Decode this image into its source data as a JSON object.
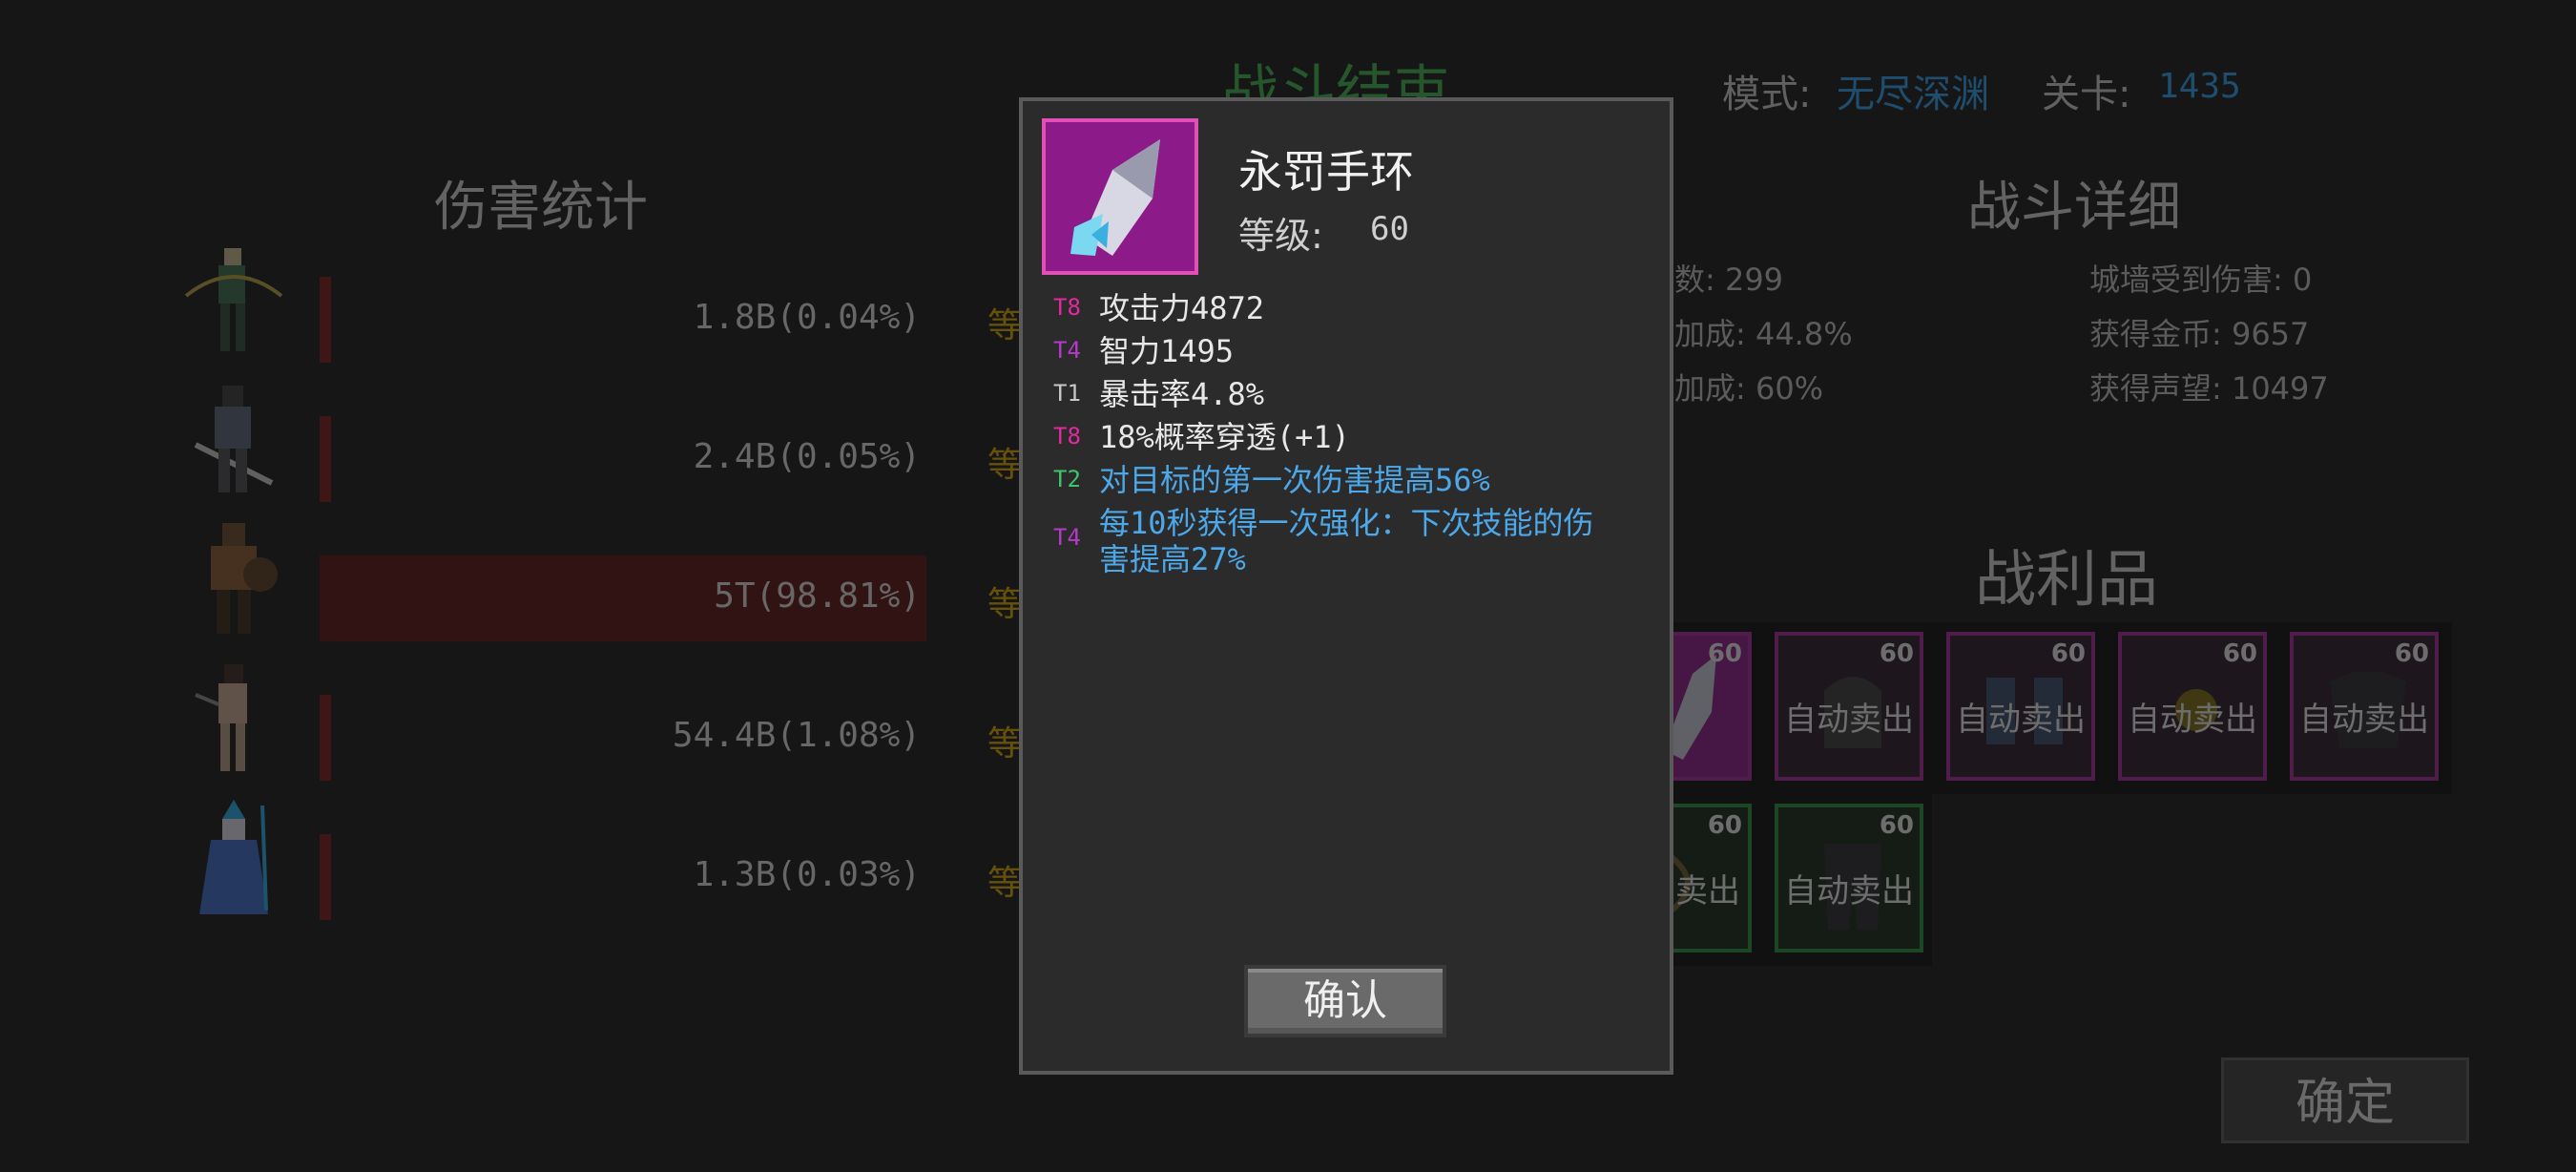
{
  "header": {
    "title": "战斗结束",
    "mode_label": "模式:",
    "mode_value": "无尽深渊",
    "level_label": "关卡:",
    "level_value": "1435"
  },
  "damage_stats": {
    "title": "伤害统计",
    "heroes": [
      {
        "damage": "1.8B(0.04%)",
        "share": 0.04,
        "extra": "等"
      },
      {
        "damage": "2.4B(0.05%)",
        "share": 0.05,
        "extra": "等"
      },
      {
        "damage": "5T(98.81%)",
        "share": 98.81,
        "extra": "等"
      },
      {
        "damage": "54.4B(1.08%)",
        "share": 1.08,
        "extra": "等"
      },
      {
        "damage": "1.3B(0.03%)",
        "share": 0.03,
        "extra": "等"
      }
    ]
  },
  "battle_details": {
    "title": "战斗详细",
    "left": [
      "数: 299",
      "加成: 44.8%",
      "加成: 60%"
    ],
    "right": [
      "城墙受到伤害: 0",
      "获得金币: 9657",
      "获得声望: 10497"
    ]
  },
  "loot": {
    "title": "战利品",
    "row1": [
      {
        "level": "60",
        "label": "",
        "rarity": "purple",
        "selected": true
      },
      {
        "level": "60",
        "label": "自动卖出",
        "rarity": "purple",
        "selected": false
      },
      {
        "level": "60",
        "label": "自动卖出",
        "rarity": "purple",
        "selected": false
      },
      {
        "level": "60",
        "label": "自动卖出",
        "rarity": "purple",
        "selected": false
      },
      {
        "level": "60",
        "label": "自动卖出",
        "rarity": "purple",
        "selected": false
      }
    ],
    "row2": [
      {
        "level": "60",
        "label": "卖出",
        "rarity": "green",
        "selected": false
      },
      {
        "level": "60",
        "label": "自动卖出",
        "rarity": "green",
        "selected": false
      }
    ]
  },
  "confirm_main": "确定",
  "popup": {
    "item_name": "永罚手环",
    "level_label": "等级:",
    "level_value": "60",
    "affixes": [
      {
        "tier": "T8",
        "tier_color": "#e02a9e",
        "text": "攻击力4872",
        "style": "white"
      },
      {
        "tier": "T4",
        "tier_color": "#b43ac8",
        "text": "智力1495",
        "style": "white"
      },
      {
        "tier": "T1",
        "tier_color": "#c8c8c8",
        "text": "暴击率4.8%",
        "style": "white"
      },
      {
        "tier": "T8",
        "tier_color": "#e02a9e",
        "text": "18%概率穿透(+1)",
        "style": "white"
      },
      {
        "tier": "T2",
        "tier_color": "#3ec46a",
        "text": "对目标的第一次伤害提高56%",
        "style": "blue"
      },
      {
        "tier": "T4",
        "tier_color": "#b43ac8",
        "text": "每10秒获得一次强化：下次技能的伤",
        "text2": "害提高27%",
        "style": "blue"
      }
    ],
    "confirm": "确认"
  },
  "colors": {
    "accent_green": "#3fb04a",
    "accent_blue": "#2f9be8",
    "rarity_purple": "#a0289a",
    "rarity_green": "#2a8a3a",
    "damage_bar": "#7a1a1a"
  },
  "icons": [
    "archer-hero-icon",
    "warrior-hero-icon",
    "barbarian-hero-icon",
    "huntress-hero-icon",
    "ice-mage-hero-icon",
    "crystal-bracer-icon",
    "helmet-icon",
    "boots-icon",
    "ring-icon",
    "armor-icon",
    "bow-icon",
    "pants-icon"
  ]
}
